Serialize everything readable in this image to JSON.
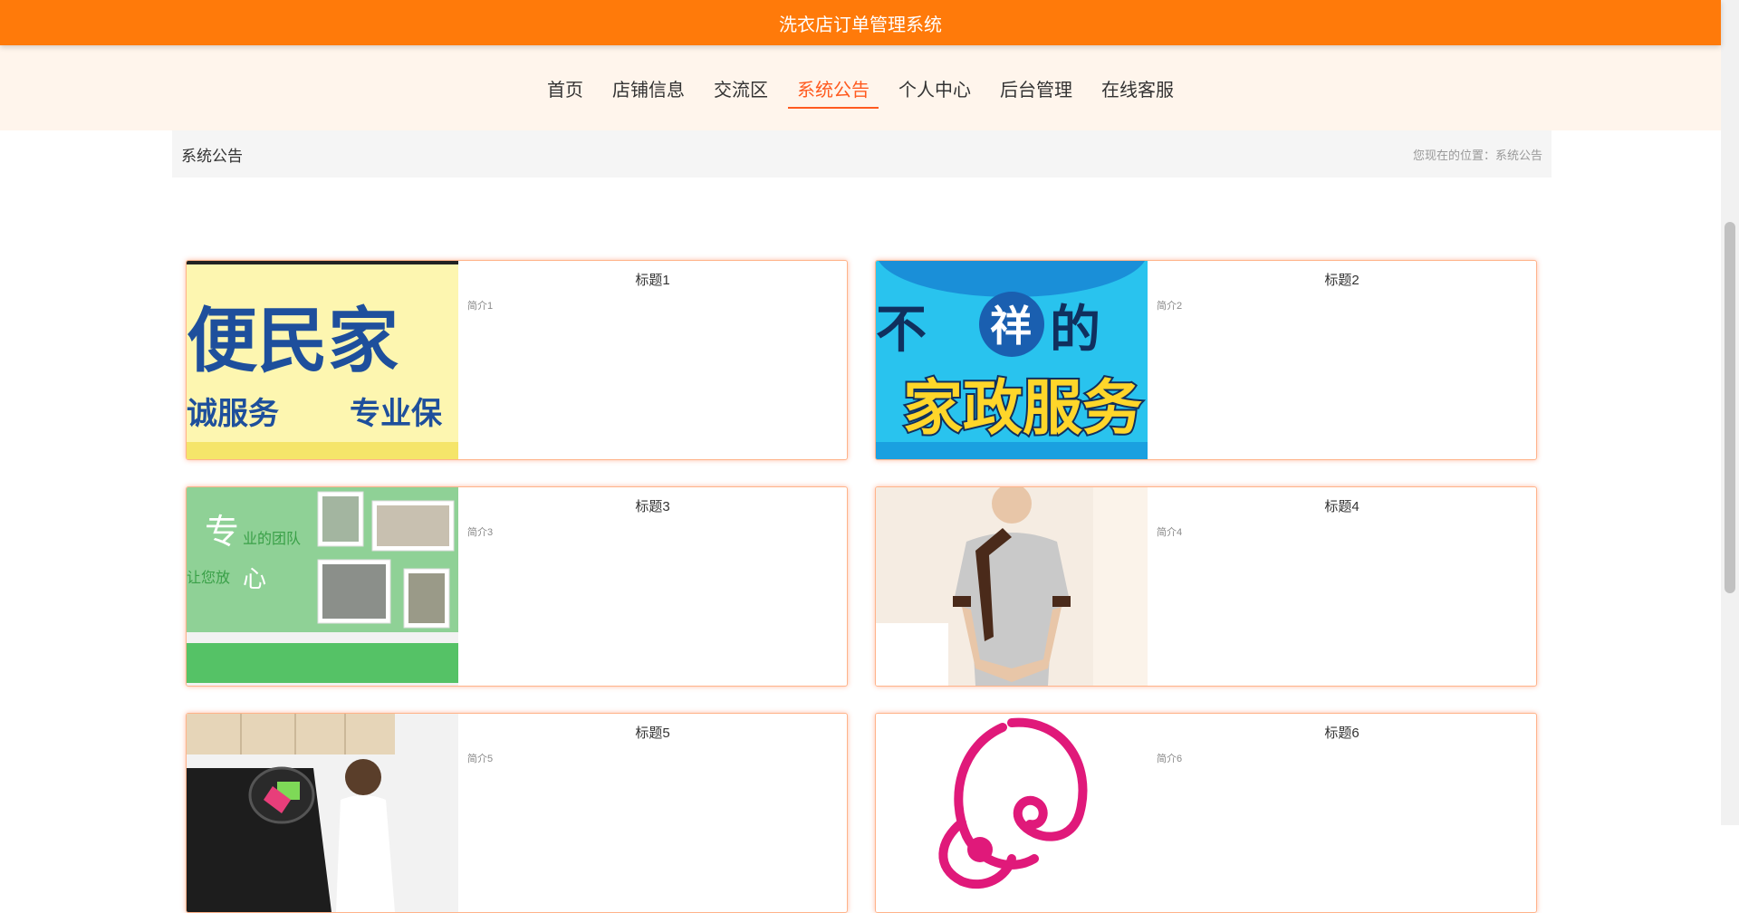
{
  "header": {
    "title": "洗衣店订单管理系统"
  },
  "nav": {
    "items": [
      "首页",
      "店铺信息",
      "交流区",
      "系统公告",
      "个人中心",
      "后台管理",
      "在线客服"
    ],
    "active_index": 3
  },
  "breadcrumb": {
    "title": "系统公告",
    "location": "您现在的位置：系统公告"
  },
  "cards": [
    {
      "title": "标题1",
      "intro": "简介1",
      "image_text": [
        "便民家",
        "诚服务",
        "专业保"
      ]
    },
    {
      "title": "标题2",
      "intro": "简介2",
      "image_text": [
        "不",
        "祥",
        "的",
        "家政服务"
      ]
    },
    {
      "title": "标题3",
      "intro": "简介3",
      "image_text": [
        "专",
        "业的团队",
        "让您放",
        "心"
      ]
    },
    {
      "title": "标题4",
      "intro": "简介4",
      "image_text": []
    },
    {
      "title": "标题5",
      "intro": "简介5",
      "image_text": []
    },
    {
      "title": "标题6",
      "intro": "简介6",
      "image_text": []
    }
  ],
  "colors": {
    "accent": "#ff7a0a",
    "nav_active": "#ff5a1f",
    "nav_bg": "#fff5ec",
    "card_border": "#ffb38a"
  }
}
